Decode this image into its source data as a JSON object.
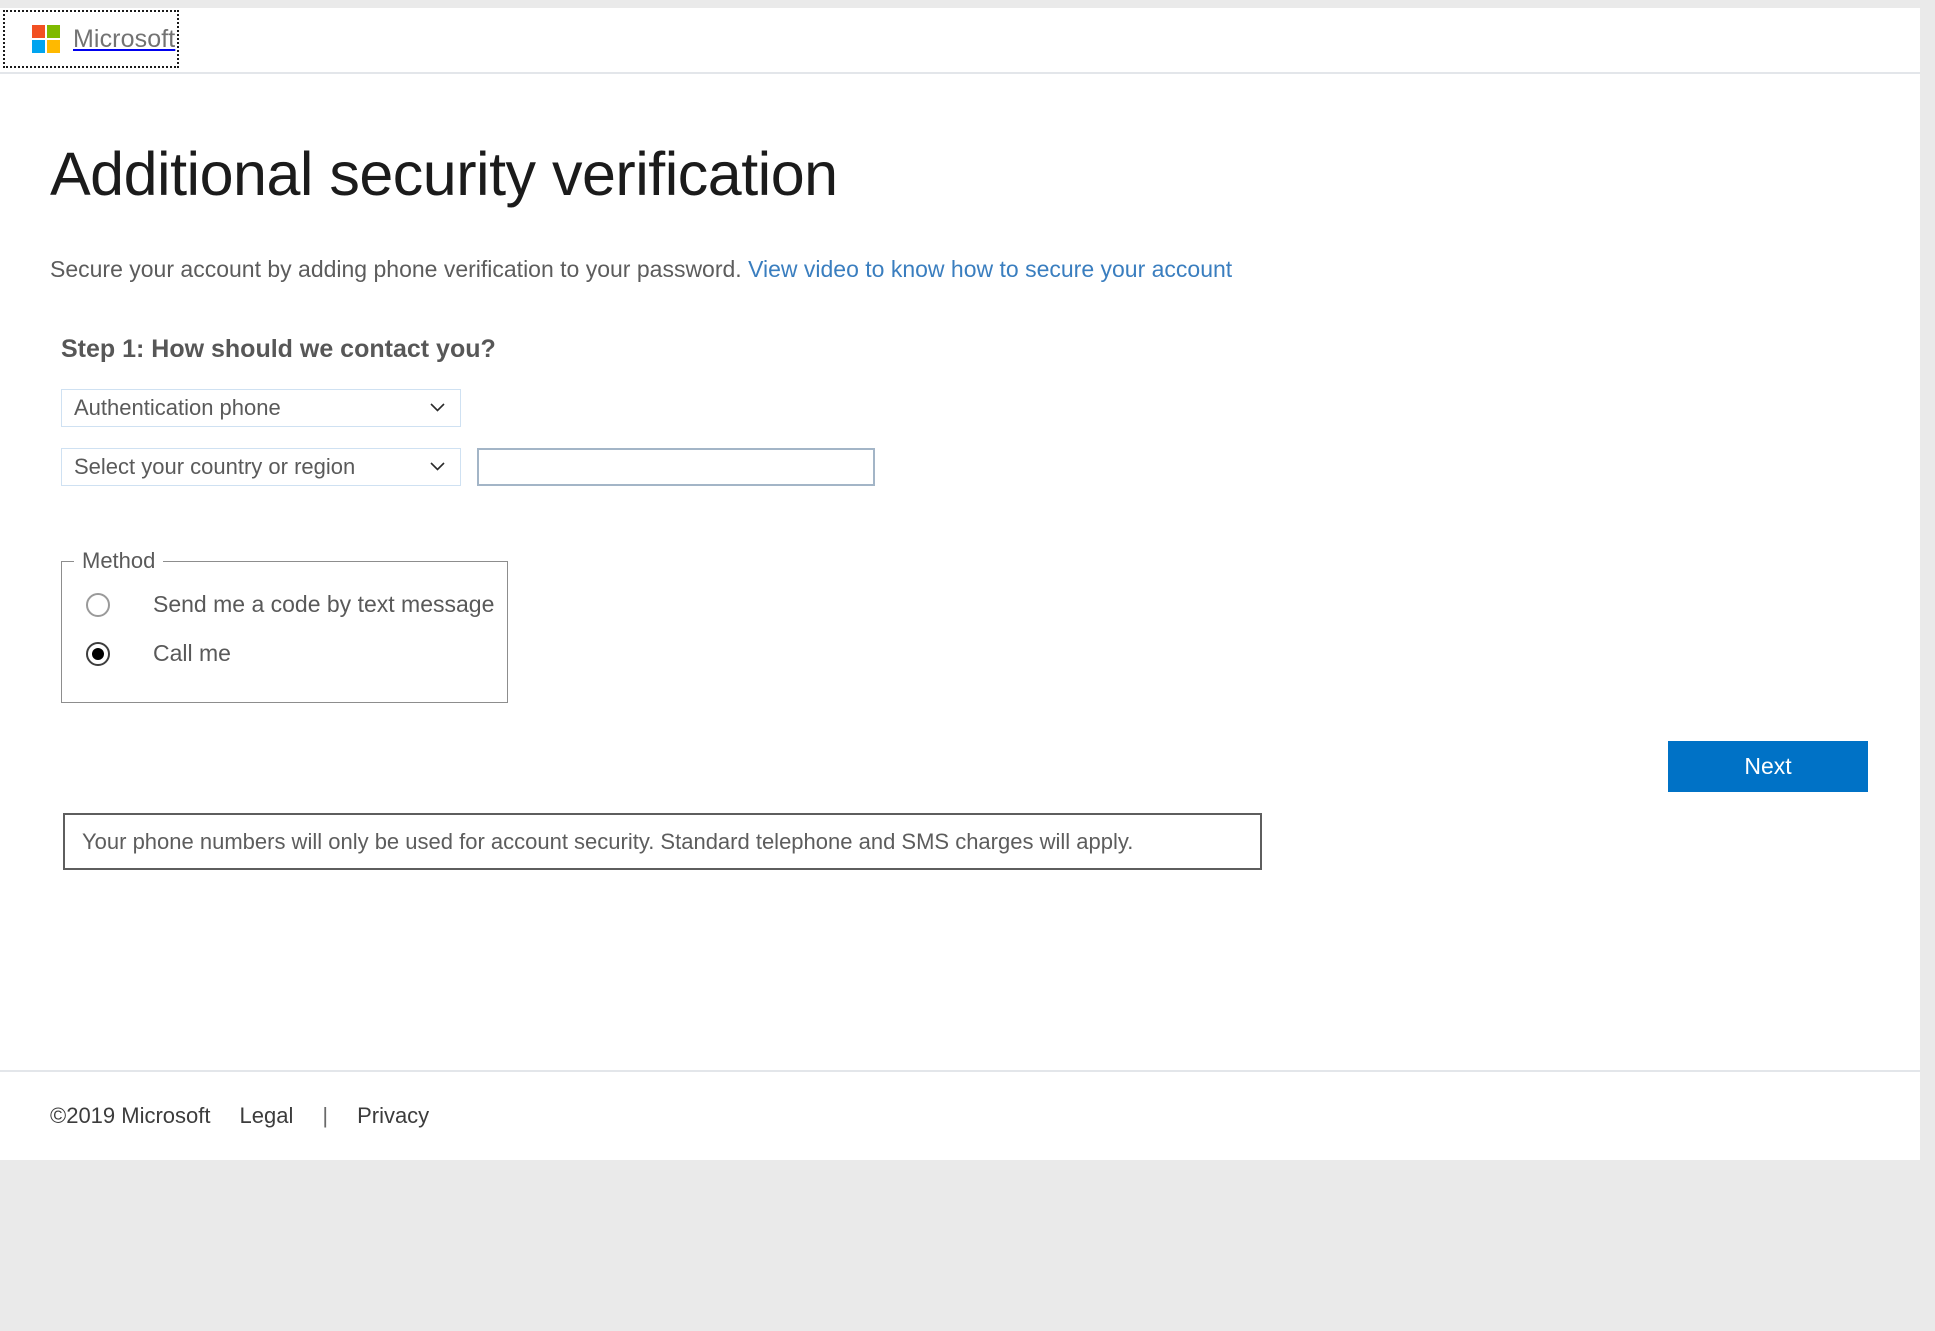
{
  "header": {
    "brand_name": "Microsoft",
    "logo_colors": {
      "top_left": "#f25022",
      "top_right": "#7fba00",
      "bottom_left": "#00a4ef",
      "bottom_right": "#ffb900"
    }
  },
  "main": {
    "page_title": "Additional security verification",
    "subtitle_text": "Secure your account by adding phone verification to your password.",
    "subtitle_link": "View video to know how to secure your account",
    "step_heading": "Step 1: How should we contact you?",
    "contact_method": {
      "selected": "Authentication phone",
      "options": [
        "Authentication phone"
      ]
    },
    "country": {
      "selected": "Select your country or region",
      "options": [
        "Select your country or region"
      ]
    },
    "phone_number": {
      "value": "",
      "placeholder": ""
    },
    "method_group": {
      "legend": "Method",
      "options": [
        {
          "label": "Send me a code by text message",
          "checked": false
        },
        {
          "label": "Call me",
          "checked": true
        }
      ]
    },
    "next_label": "Next",
    "disclaimer": "Your phone numbers will only be used for account security. Standard telephone and SMS charges will apply."
  },
  "footer": {
    "copyright": "©2019 Microsoft",
    "legal": "Legal",
    "separator": "|",
    "privacy": "Privacy"
  },
  "colors": {
    "accent_blue": "#0072c6",
    "link_blue": "#3a7ebf",
    "text_gray": "#5a5a5a"
  }
}
